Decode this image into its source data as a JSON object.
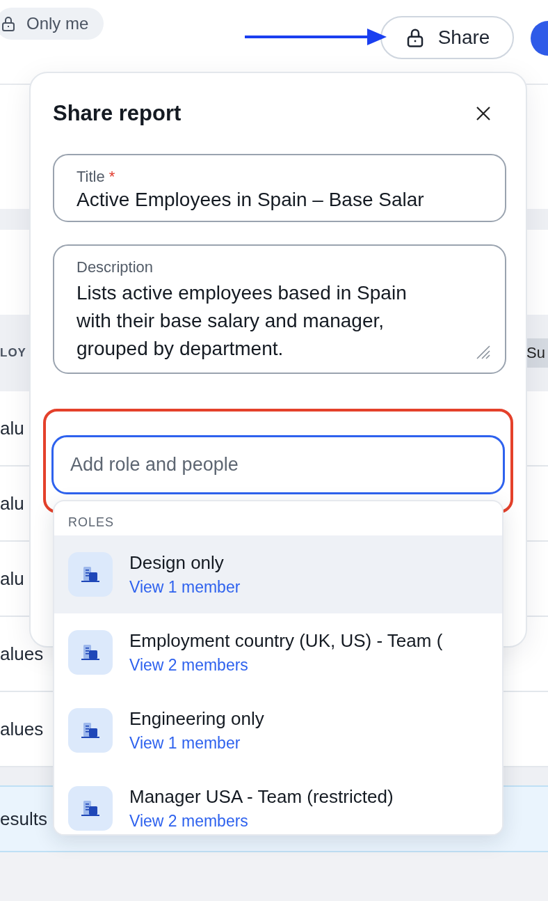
{
  "top_bar": {
    "visibility_chip": {
      "label": "Only me"
    },
    "share_button": {
      "label": "Share"
    }
  },
  "background_table": {
    "header": "LOY",
    "badge": "Su",
    "rows": [
      "alu",
      "alu",
      "alu",
      "alues",
      "alues"
    ],
    "footer": "esults"
  },
  "share_dialog": {
    "title": "Share report",
    "fields": [
      {
        "kind": "input",
        "label": "Title",
        "required_mark": "*",
        "value": "Active Employees in Spain – Base Salar"
      },
      {
        "kind": "textarea",
        "label": "Description",
        "value": "Lists active employees based in Spain with their base salary and manager, grouped by department."
      }
    ],
    "people_input": {
      "placeholder": "Add role and people",
      "focused": true
    },
    "dropdown": {
      "section": "ROLES",
      "items": [
        {
          "name": "Design only",
          "link": "View 1 member",
          "selected": true
        },
        {
          "name": "Employment country (UK, US) - Team (",
          "link": "View 2 members",
          "selected": false
        },
        {
          "name": "Engineering only",
          "link": "View 1 member",
          "selected": false
        },
        {
          "name": "Manager USA - Team (restricted)",
          "link": "View 2 members",
          "selected": false
        }
      ]
    }
  }
}
